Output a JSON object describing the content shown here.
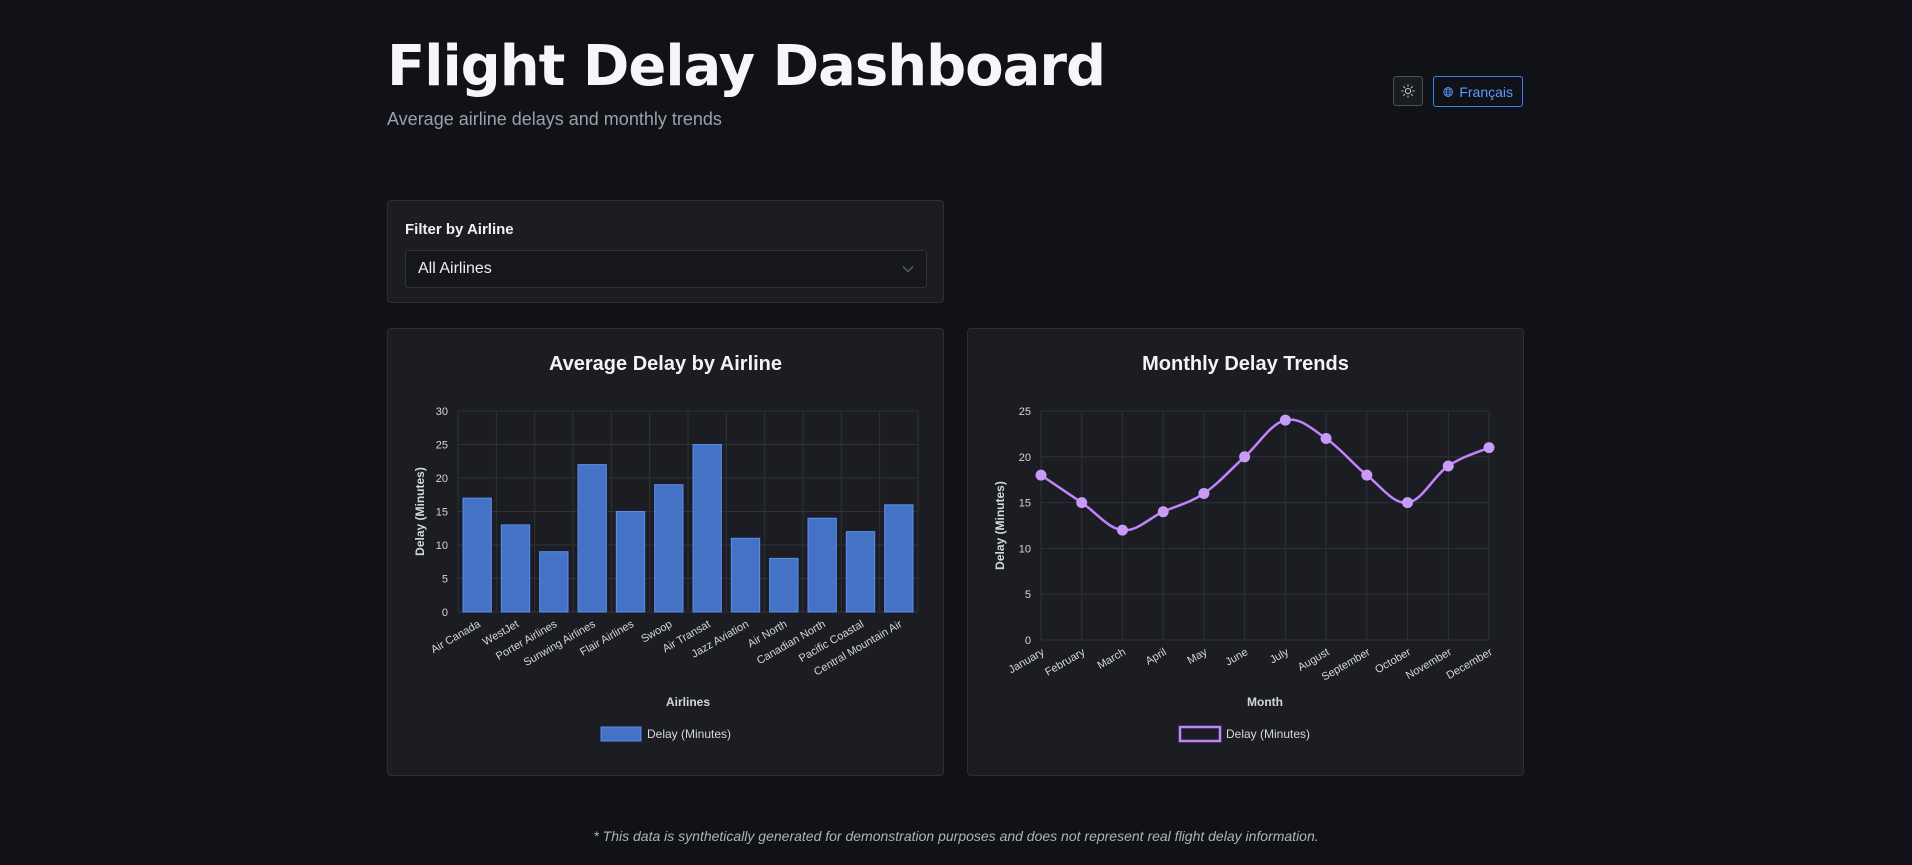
{
  "header": {
    "title": "Flight Delay Dashboard",
    "subtitle": "Average airline delays and monthly trends",
    "theme_icon": "sun-icon",
    "lang_icon": "globe-icon",
    "lang_label": "Français"
  },
  "filter": {
    "label": "Filter by Airline",
    "selected": "All Airlines",
    "chevron_icon": "chevron-down-icon"
  },
  "footnote": "* This data is synthetically generated for demonstration purposes and does not represent real flight delay information.",
  "colors": {
    "bar_fill": "#4472c4",
    "bar_stroke": "#5b8def",
    "line": "#c084fc",
    "point": "#c89bf7",
    "accent": "#3b82f6"
  },
  "chart_data": [
    {
      "type": "bar",
      "title": "Average Delay by Airline",
      "xlabel": "Airlines",
      "ylabel": "Delay (Minutes)",
      "categories": [
        "Air Canada",
        "WestJet",
        "Porter Airlines",
        "Sunwing Airlines",
        "Flair Airlines",
        "Swoop",
        "Air Transat",
        "Jazz Aviation",
        "Air North",
        "Canadian North",
        "Pacific Coastal",
        "Central Mountain Air"
      ],
      "series": [
        {
          "name": "Delay (Minutes)",
          "values": [
            17,
            13,
            9,
            22,
            15,
            19,
            25,
            11,
            8,
            14,
            12,
            16
          ]
        }
      ],
      "ylim": [
        0,
        30
      ],
      "yticks": [
        0,
        5,
        10,
        15,
        20,
        25,
        30
      ],
      "grid": true,
      "legend": "bottom"
    },
    {
      "type": "line",
      "title": "Monthly Delay Trends",
      "xlabel": "Month",
      "ylabel": "Delay (Minutes)",
      "categories": [
        "January",
        "February",
        "March",
        "April",
        "May",
        "June",
        "July",
        "August",
        "September",
        "October",
        "November",
        "December"
      ],
      "series": [
        {
          "name": "Delay (Minutes)",
          "values": [
            18,
            15,
            12,
            14,
            16,
            20,
            24,
            22,
            18,
            15,
            19,
            21
          ]
        }
      ],
      "ylim": [
        0,
        25
      ],
      "yticks": [
        0,
        5,
        10,
        15,
        20,
        25
      ],
      "grid": true,
      "legend": "bottom"
    }
  ]
}
